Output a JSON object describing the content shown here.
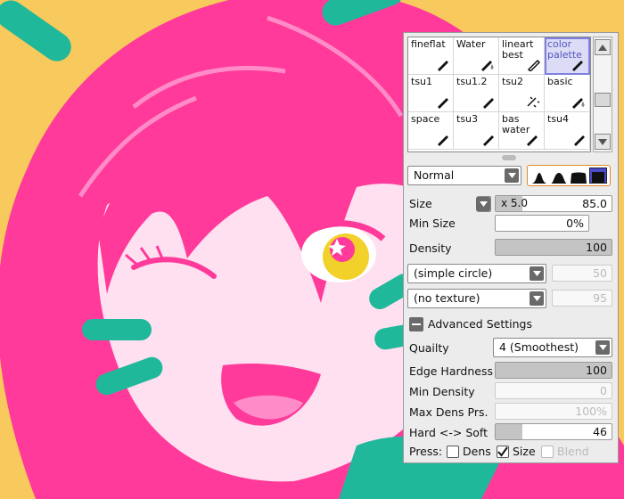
{
  "palette": {
    "background": "#f8c95c",
    "hair": "#ff3a9a",
    "skin": "#ffe0f0",
    "accent": "#1fb89a",
    "eye": "#f2d12a"
  },
  "brush_tools": [
    {
      "label": "fineflat",
      "icon": "pen-icon"
    },
    {
      "label": "Water",
      "icon": "water-brush-icon"
    },
    {
      "label": "lineart best",
      "icon": "pencil-icon"
    },
    {
      "label": "color palette",
      "icon": "water-brush-icon",
      "selected": true
    },
    {
      "label": "tsu1",
      "icon": "pen-icon"
    },
    {
      "label": "tsu1.2",
      "icon": "pen-icon"
    },
    {
      "label": "tsu2",
      "icon": "scatter-brush-icon"
    },
    {
      "label": "basic",
      "icon": "water-brush-icon"
    },
    {
      "label": "space",
      "icon": "pen-icon"
    },
    {
      "label": "tsu3",
      "icon": "pen-icon"
    },
    {
      "label": "bas water",
      "icon": "water-brush-icon"
    },
    {
      "label": "tsu4",
      "icon": "pen-icon"
    }
  ],
  "blend_mode": "Normal",
  "size": {
    "label": "Size",
    "multiplier": "x 5.0",
    "value": "85.0"
  },
  "min_size": {
    "label": "Min Size",
    "value": "0%"
  },
  "density": {
    "label": "Density",
    "value": "100",
    "fraction": 1.0
  },
  "shape_select": {
    "value": "(simple circle)",
    "amount": "50"
  },
  "texture_select": {
    "value": "(no texture)",
    "amount": "95"
  },
  "advanced": {
    "header": "Advanced Settings",
    "quality_label": "Quailty",
    "quality_value": "4 (Smoothest)",
    "edge_hardness": {
      "label": "Edge Hardness",
      "value": "100",
      "fraction": 1.0
    },
    "min_density": {
      "label": "Min Density",
      "value": "0",
      "fraction": 0
    },
    "max_dens_prs": {
      "label": "Max Dens Prs.",
      "value": "100%",
      "fraction": 1.0
    },
    "hard_soft": {
      "label": "Hard <-> Soft",
      "value": "46",
      "fraction": 0.46
    }
  },
  "press": {
    "label": "Press:",
    "dens": {
      "label": "Dens",
      "checked": false
    },
    "size": {
      "label": "Size",
      "checked": true
    },
    "blend": {
      "label": "Blend",
      "checked": false
    }
  }
}
